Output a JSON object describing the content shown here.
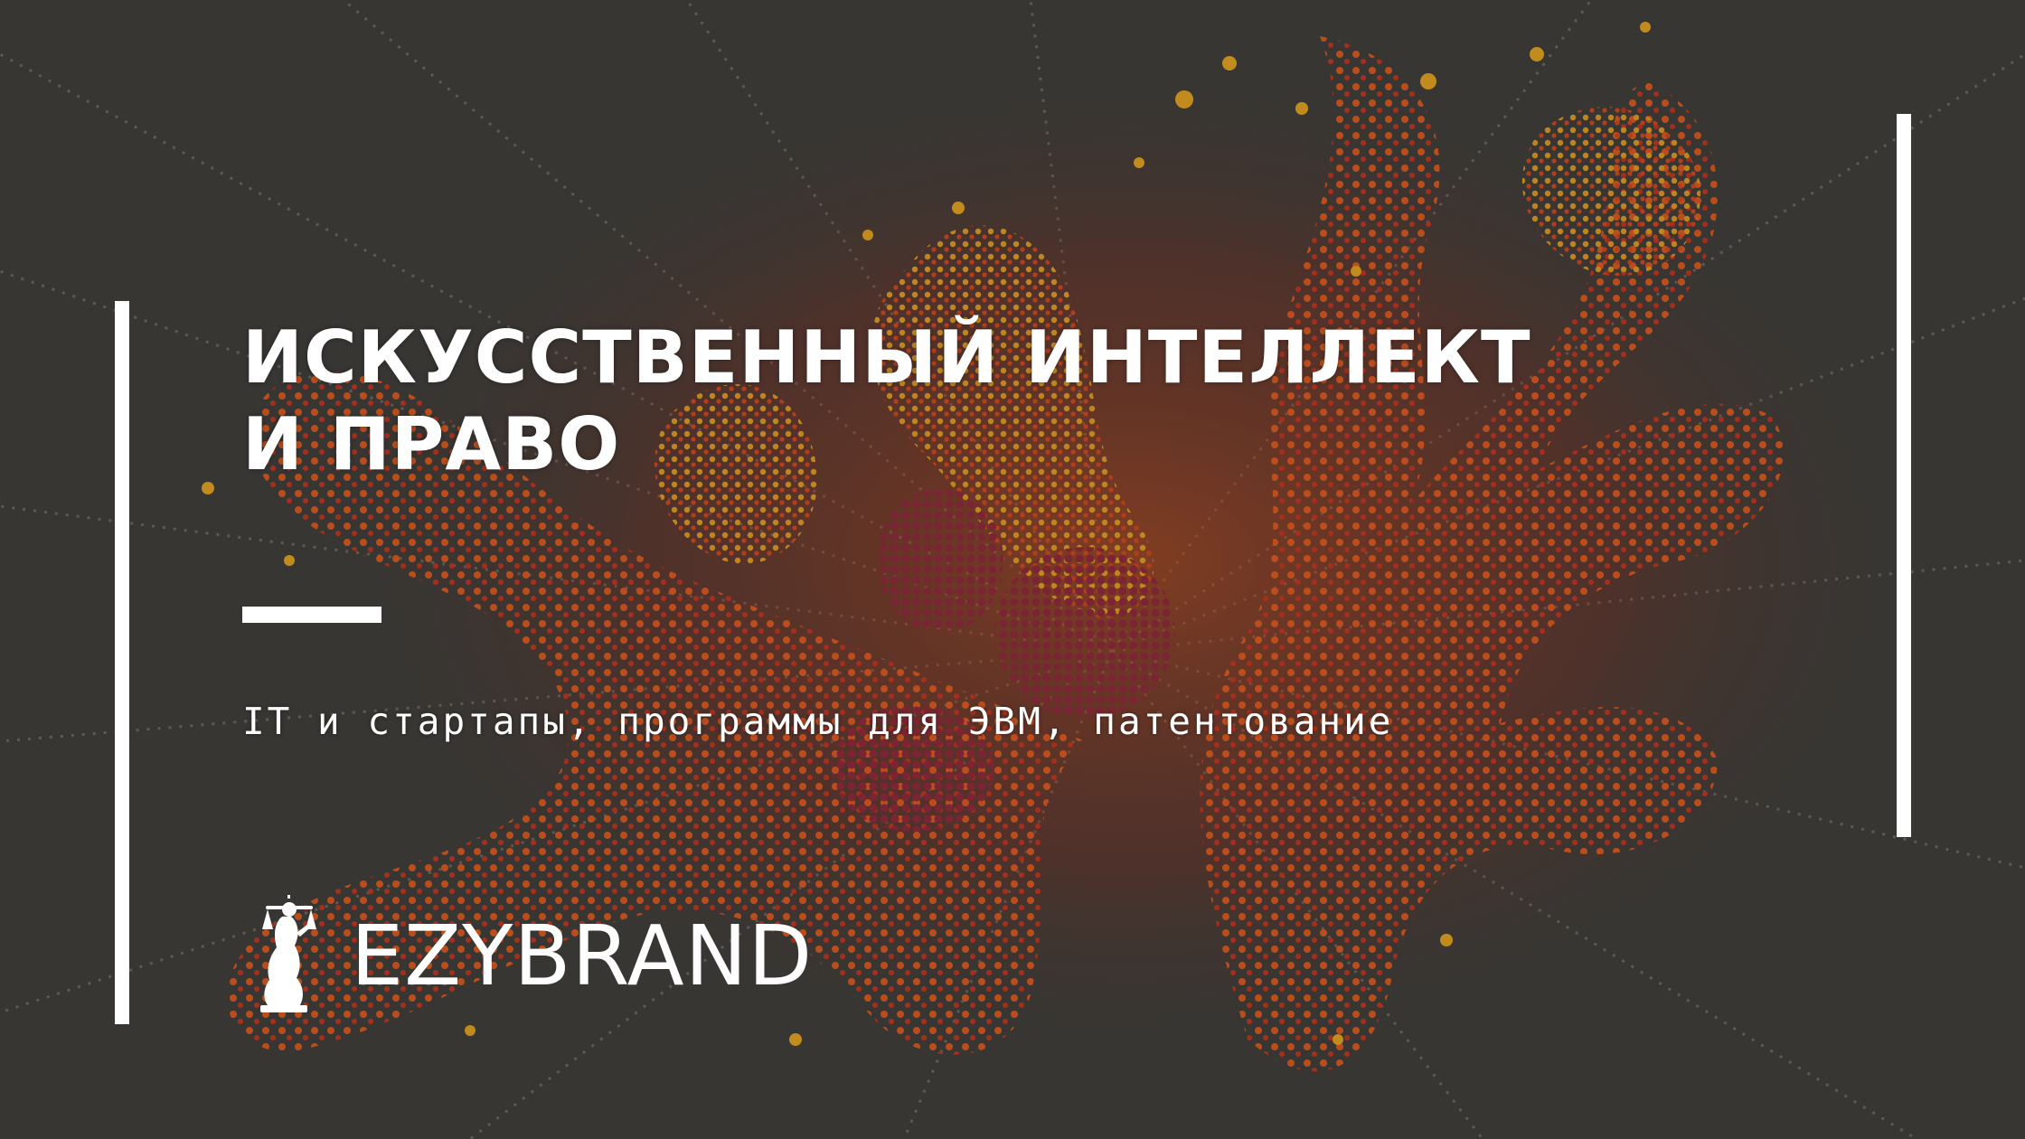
{
  "slide": {
    "title_line_1": "ИСКУССТВЕННЫЙ ИНТЕЛЛЕКТ",
    "title_line_2": "И ПРАВО",
    "subtitle": "IT и стартапы, программы для ЭВМ, патентование",
    "background_image": "abstract-orange-red-particle-coral-icon",
    "colors": {
      "background": "#3b3a37",
      "text": "#ffffff",
      "accent_orange": "#e25a16",
      "accent_red": "#b3161a"
    }
  },
  "logo": {
    "brand_name": "EZYBRAND",
    "icon": "lady-justice-icon"
  }
}
